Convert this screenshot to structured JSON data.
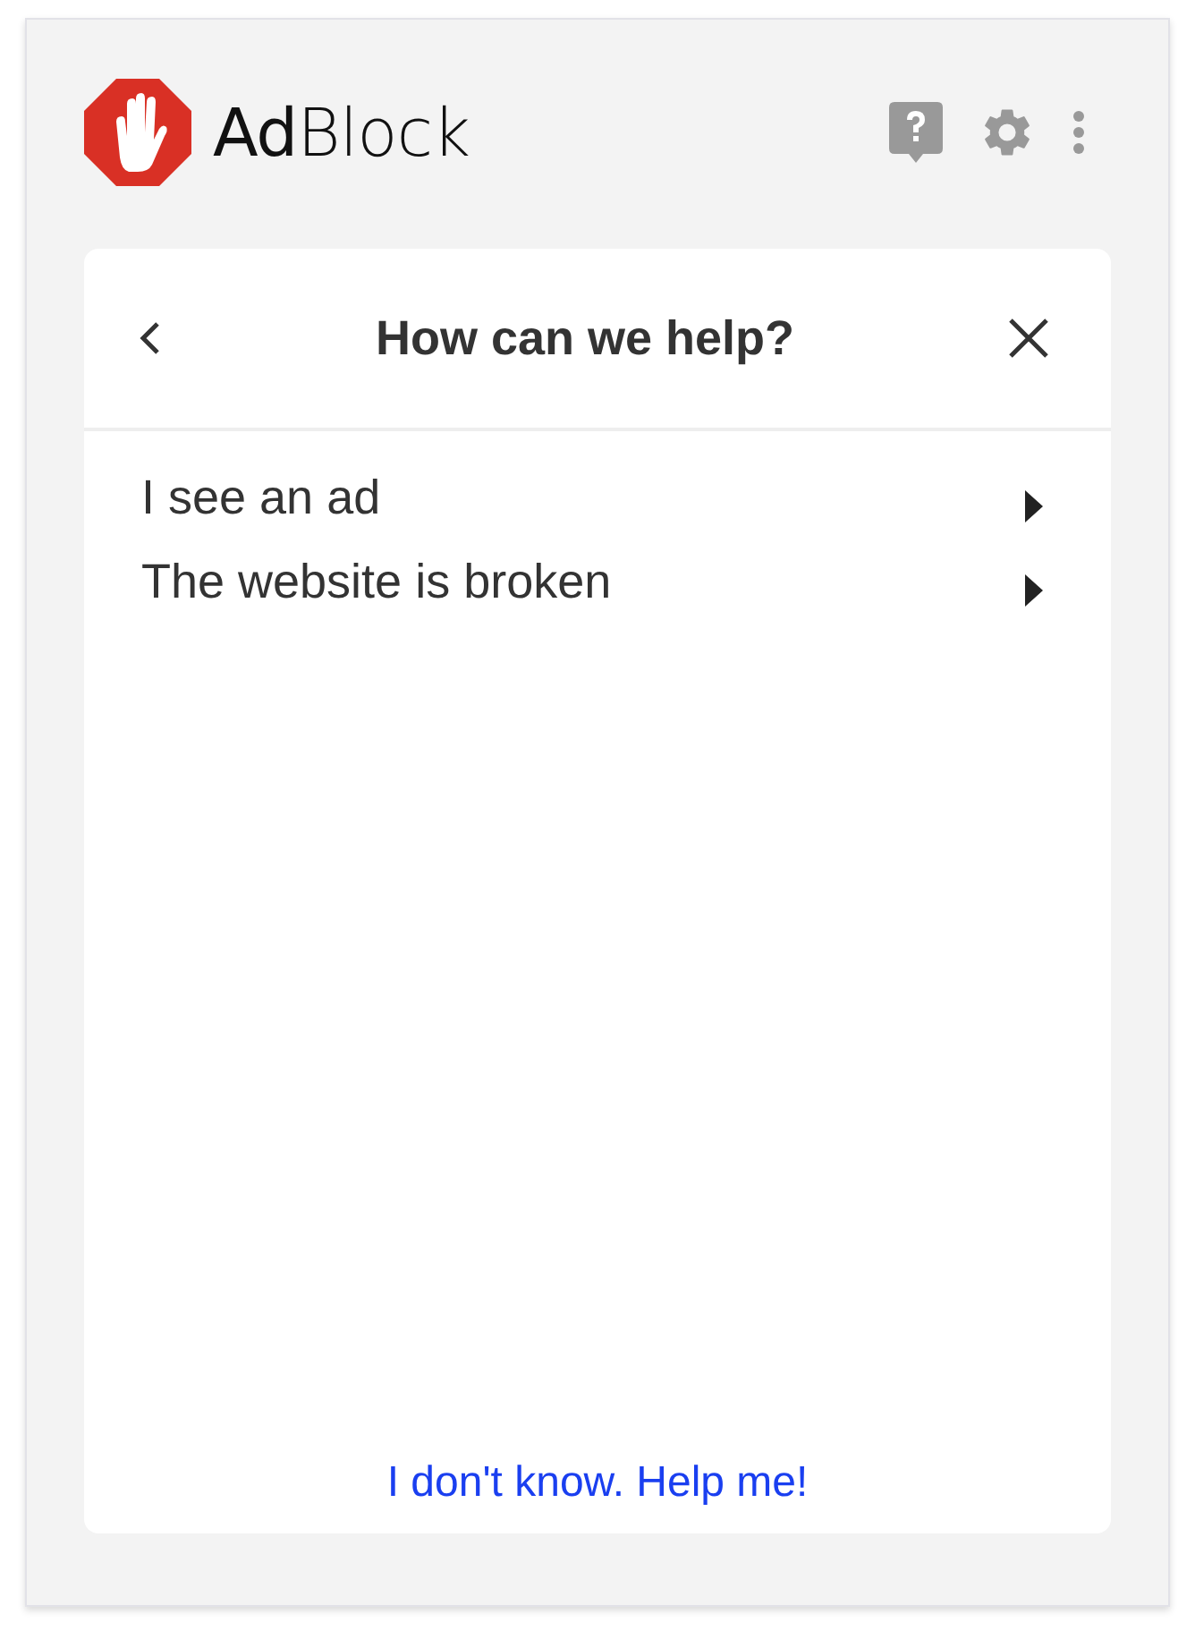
{
  "header": {
    "logo": "**Ad**Block"
  },
  "dialog": {
    "title": "How can we help?"
  },
  "options": [
    {
      "label": "I see an ad"
    },
    {
      "label": "The website is broken"
    }
  ],
  "footer_link": "I don't know. Help me!"
}
